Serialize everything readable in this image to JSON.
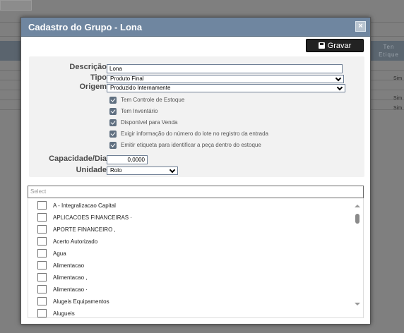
{
  "background": {
    "header_right": "Ten Etique",
    "rows": [
      "Sim",
      "Sim",
      "Sim"
    ]
  },
  "modal": {
    "title": "Cadastro do Grupo - Lona",
    "close_glyph": "×",
    "save_label": "Gravar",
    "save_icon": "floppy-disk-icon"
  },
  "form": {
    "descricao_label": "Descrição",
    "descricao_value": "Lona",
    "tipo_label": "Tipo",
    "tipo_value": "Produto Final",
    "origem_label": "Origem",
    "origem_value": "Produzido Internamente",
    "checkboxes": [
      {
        "label": "Tem Controle de Estoque",
        "checked": true
      },
      {
        "label": "Tem Inventário",
        "checked": true
      },
      {
        "label": "Disponível para Venda",
        "checked": true
      },
      {
        "label": "Exigir informação do número do lote no registro da entrada",
        "checked": true
      },
      {
        "label": "Emitir etiqueta para identificar a peça dentro do estoque",
        "checked": true
      }
    ],
    "capacidade_label": "Capacidade/Dia",
    "capacidade_value": "0,0000",
    "unidade_label": "Unidade",
    "unidade_value": "Rolo"
  },
  "list": {
    "search_placeholder": "Select",
    "items": [
      "A - Integralizacao Capital",
      "APLICACOES FINANCEIRAS ·",
      "APORTE FINANCEIRO ,",
      "Acerto Autorizado",
      "Agua",
      "Alimentacao",
      "Alimentacao ,",
      "Alimentacao ·",
      "Alugeis Equipamentos",
      "Alugueis"
    ]
  }
}
